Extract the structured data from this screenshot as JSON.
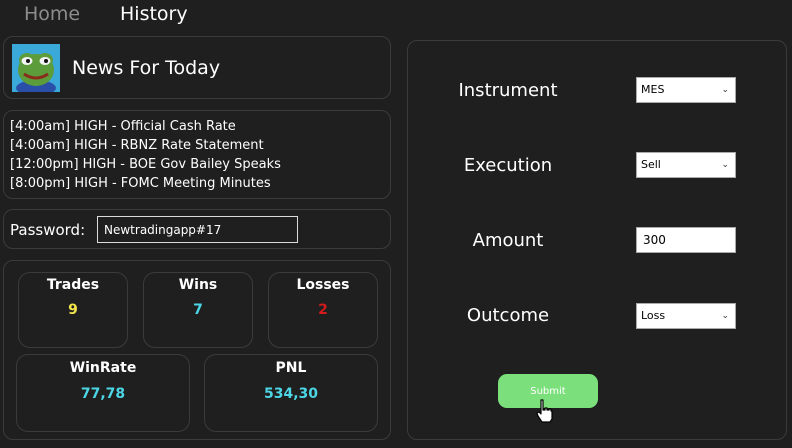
{
  "nav": {
    "home_label": "Home",
    "history_label": "History"
  },
  "news": {
    "title": "News For Today",
    "items": [
      "[4:00am] HIGH - Official Cash Rate",
      "[4:00am] HIGH - RBNZ Rate Statement",
      "[12:00pm] HIGH - BOE Gov Bailey Speaks",
      "[8:00pm] HIGH - FOMC Meeting Minutes"
    ]
  },
  "password": {
    "label": "Password:",
    "value": "Newtradingapp#17"
  },
  "stats": {
    "trades_label": "Trades",
    "trades_value": "9",
    "wins_label": "Wins",
    "wins_value": "7",
    "losses_label": "Losses",
    "losses_value": "2",
    "winrate_label": "WinRate",
    "winrate_value": "77,78",
    "pnl_label": "PNL",
    "pnl_value": "534,30"
  },
  "form": {
    "instrument_label": "Instrument",
    "instrument_value": "MES",
    "execution_label": "Execution",
    "execution_value": "Sell",
    "amount_label": "Amount",
    "amount_value": "300",
    "outcome_label": "Outcome",
    "outcome_value": "Loss",
    "submit_label": "Submit"
  },
  "colors": {
    "background": "#1f1f1f",
    "border": "#3b3b3b",
    "trades_value": "#f3e54c",
    "wins_value": "#4dd6e6",
    "losses_value": "#d21c1c",
    "winrate_value": "#4dd6e6",
    "pnl_value": "#4dd6e6",
    "submit_bg": "#7be07b"
  },
  "icons": {
    "avatar": "pepe-frog-avatar",
    "cursor": "hand-pointer-cursor"
  }
}
